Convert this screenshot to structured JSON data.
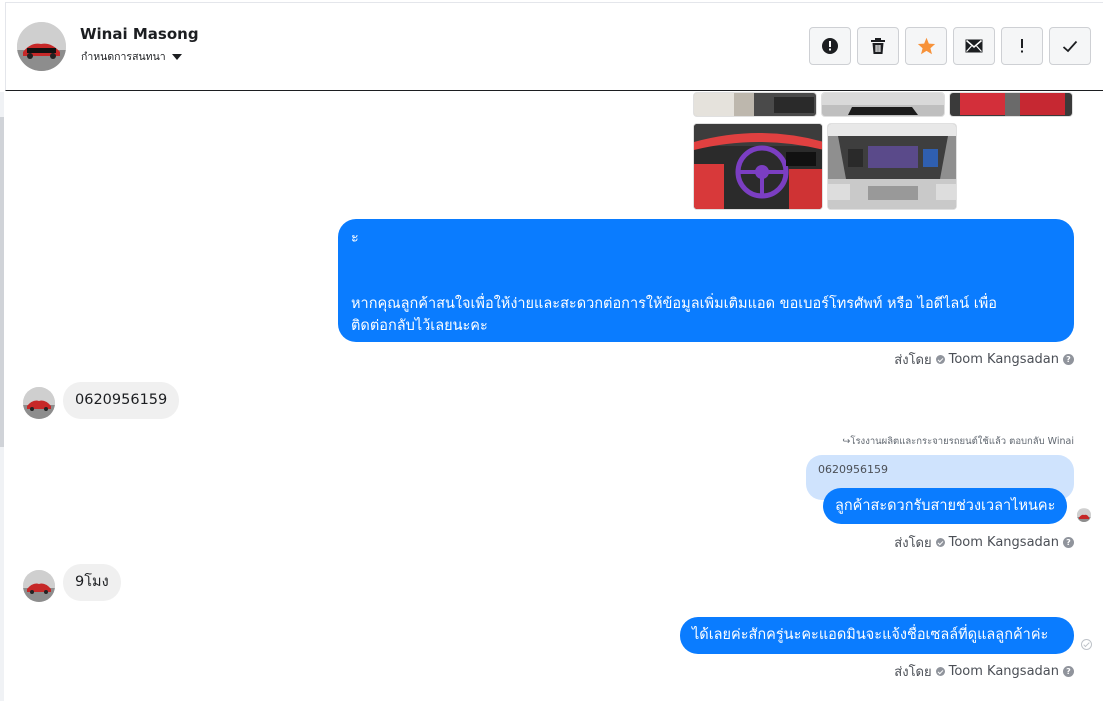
{
  "header": {
    "user_name": "Winai Masong",
    "conversation_setting": "กำหนดการสนทนา",
    "toolbar": [
      {
        "icon": "alert-circle-icon",
        "label": "Report"
      },
      {
        "icon": "trash-icon",
        "label": "Delete"
      },
      {
        "icon": "star-icon",
        "label": "Star"
      },
      {
        "icon": "envelope-icon",
        "label": "Mark unread"
      },
      {
        "icon": "exclamation-icon",
        "label": "Important"
      },
      {
        "icon": "checkmark-icon",
        "label": "Done"
      }
    ]
  },
  "messages": {
    "outgoing_long": {
      "line1": "ะ",
      "line2": "หากคุณลูกค้าสนใจเพื่อให้ง่ายและสะดวกต่อการให้ข้อมูลเพิ่มเติมแอด ขอเบอร์โทรศัพท์ หรือ ไอดีไลน์ เพื่อ",
      "line3": "ติดต่อกลับไว้เลยนะคะ"
    },
    "sent_by_1": {
      "prefix": "ส่งโดย",
      "agent": "Toom Kangsadan"
    },
    "incoming_phone": "0620956159",
    "reply_note": "โรงงานผลิตและกระจายรถยนต์ใช้แล้ว ตอบกลับ Winai",
    "quoted_text": "0620956159",
    "outgoing_reply": "ลูกค้าสะดวกรับสายช่วงเวลาไหนคะ",
    "sent_by_2": {
      "prefix": "ส่งโดย",
      "agent": "Toom Kangsadan"
    },
    "incoming_time": "9โมง",
    "outgoing_final": "ได้เลยค่ะสักครู่นะคะแอดมินจะแจ้งชื่อเซลล์ที่ดูแลลูกค้าค่ะ",
    "sent_by_3": {
      "prefix": "ส่งโดย",
      "agent": "Toom Kangsadan"
    }
  },
  "colors": {
    "brand_blue": "#0a7cff",
    "bubble_in": "#f0f0f0",
    "quoted_bg": "#cfe3fd",
    "star_orange": "#f7923a"
  }
}
